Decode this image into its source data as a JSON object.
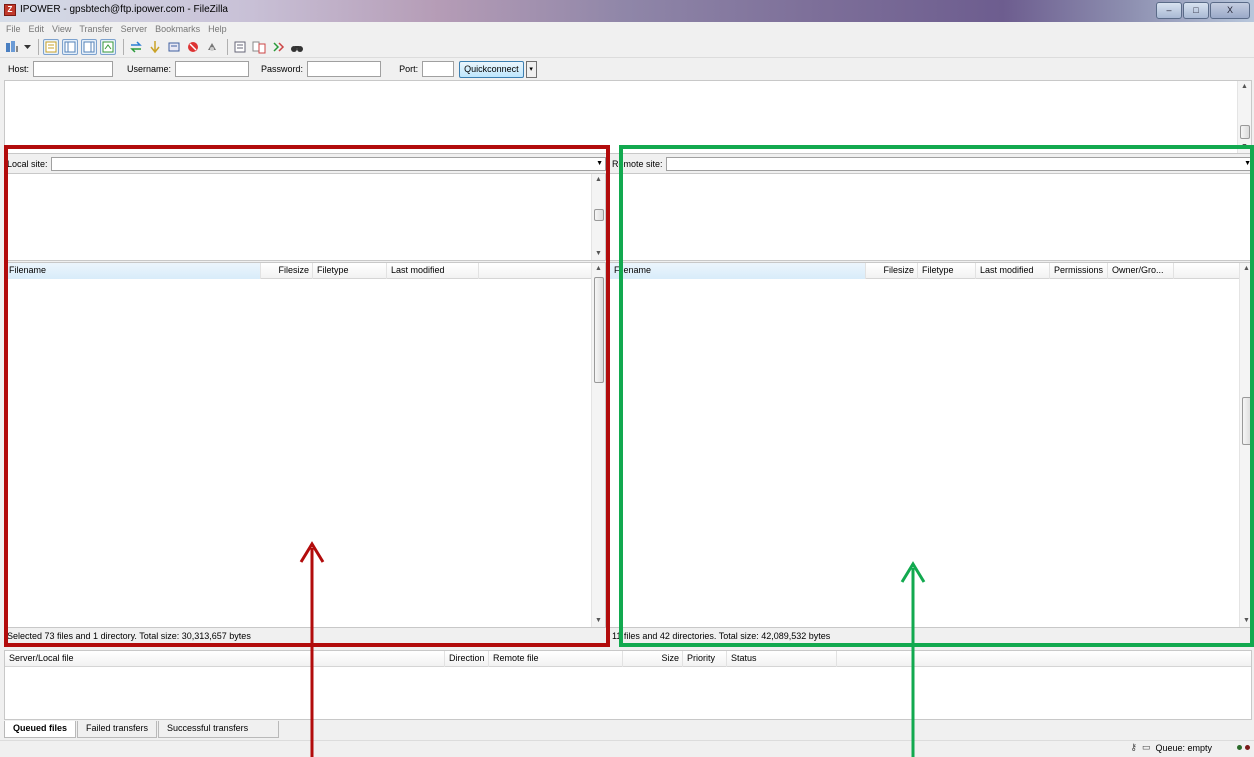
{
  "window": {
    "title": "IPOWER - gpsbtech@ftp.ipower.com - FileZilla",
    "app_icon_glyph": "Z",
    "minimize_glyph": "–",
    "maximize_glyph": "□",
    "close_glyph": "X"
  },
  "menu": [
    "File",
    "Edit",
    "View",
    "Transfer",
    "Server",
    "Bookmarks",
    "Help"
  ],
  "toolbar": {
    "icons": [
      "site-manager-icon",
      "dropdown-icon",
      "toggle-message-log-icon",
      "toggle-local-tree-icon",
      "toggle-remote-tree-icon",
      "toggle-queue-icon",
      "refresh-icon",
      "process-queue-icon",
      "cancel-operation-icon",
      "disconnect-icon",
      "reconnect-icon",
      "directory-listing-filters-icon",
      "toggle-compare-icon",
      "synchronized-browsing-icon",
      "search-icon"
    ]
  },
  "quickconnect": {
    "host_label": "Host:",
    "host_value": "",
    "username_label": "Username:",
    "username_value": "",
    "password_label": "Password:",
    "password_value": "",
    "port_label": "Port:",
    "port_value": "",
    "button_label": "Quickconnect",
    "dropdown_glyph": "▾"
  },
  "local": {
    "site_label": "Local site:",
    "site_value": "",
    "columns": [
      "Filename",
      "Filesize",
      "Filetype",
      "Last modified"
    ],
    "status": "Selected 73 files and 1 directory. Total size: 30,313,657 bytes"
  },
  "remote": {
    "site_label": "Remote site:",
    "site_value": "",
    "columns": [
      "Filename",
      "Filesize",
      "Filetype",
      "Last modified",
      "Permissions",
      "Owner/Gro..."
    ],
    "status": "11 files and 42 directories. Total size: 42,089,532 bytes"
  },
  "queue": {
    "columns": [
      "Server/Local file",
      "Direction",
      "Remote file",
      "Size",
      "Priority",
      "Status"
    ],
    "tabs": [
      "Queued files",
      "Failed transfers",
      "Successful transfers"
    ]
  },
  "statusbar": {
    "queue_text": "Queue: empty"
  },
  "annotations": {
    "left_box_color": "#b20c0c",
    "right_box_color": "#12a94f"
  }
}
